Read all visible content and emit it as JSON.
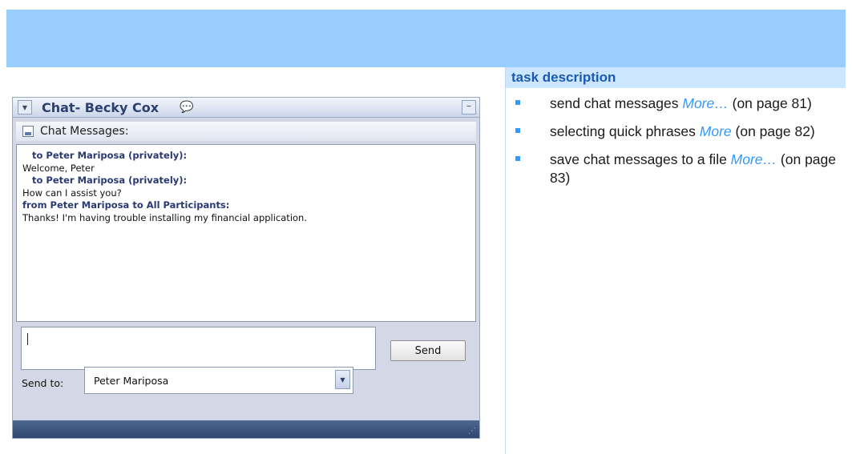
{
  "right_panel": {
    "header": "task description",
    "items": [
      {
        "text": "send chat messages ",
        "more": "More…",
        "suffix": " (on page 81)"
      },
      {
        "text": "selecting quick phrases ",
        "more": "More",
        "suffix": " (on page 82)"
      },
      {
        "text": "save chat messages to a file ",
        "more": "More…",
        "suffix": " (on page 83)"
      }
    ]
  },
  "chat_window": {
    "title": "Chat- Becky Cox",
    "messages_header": "Chat Messages:",
    "messages": [
      {
        "kind": "to",
        "text": "to Peter Mariposa  (privately):"
      },
      {
        "kind": "text",
        "text": "Welcome, Peter"
      },
      {
        "kind": "to",
        "text": "to Peter Mariposa  (privately):"
      },
      {
        "kind": "text",
        "text": "How can I assist you?"
      },
      {
        "kind": "from",
        "text": "from Peter Mariposa to All Participants:"
      },
      {
        "kind": "text",
        "text": "Thanks!  I'm having trouble installing my financial application."
      }
    ],
    "send_label": "Send",
    "send_to_label": "Send to:",
    "send_to_value": "Peter Mariposa"
  },
  "colors": {
    "band": "#99ccff",
    "header_bg": "#cce6ff",
    "accent": "#3399ff"
  }
}
